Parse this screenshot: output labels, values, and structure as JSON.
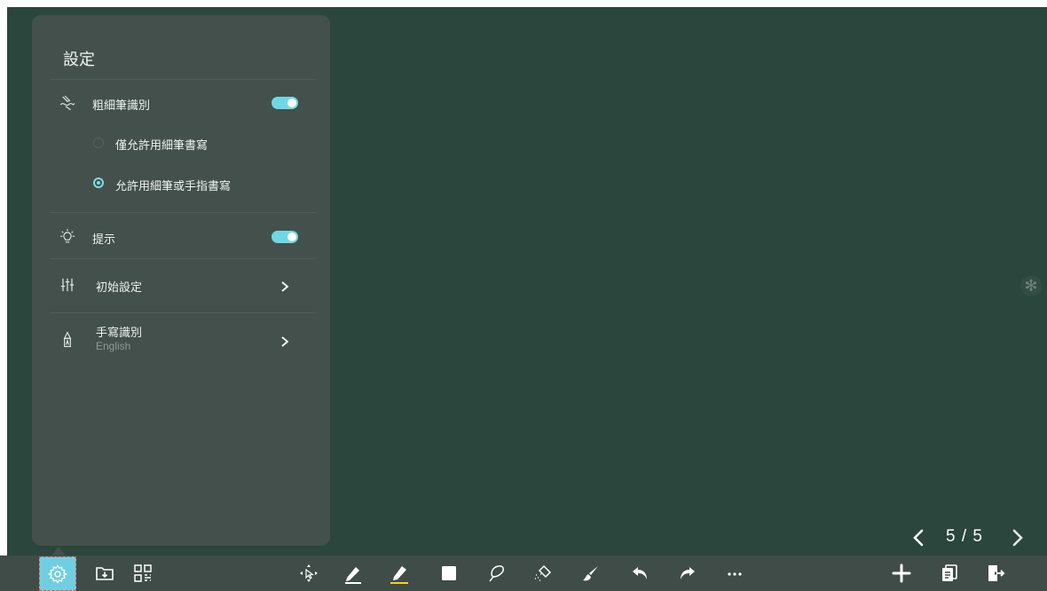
{
  "settings_panel": {
    "title": "設定",
    "rows": [
      {
        "icon": "pen-detect-icon",
        "label": "粗細筆識別",
        "toggle": true
      },
      {
        "icon": "lightbulb-icon",
        "label": "提示",
        "toggle": true
      },
      {
        "icon": "sliders-icon",
        "label": "初始設定"
      },
      {
        "icon": "handwriting-icon",
        "label": "手寫識別",
        "sub": "English"
      }
    ],
    "radio_options": [
      {
        "label": "僅允許用細筆書寫",
        "selected": false
      },
      {
        "label": "允許用細筆或手指書寫",
        "selected": true
      }
    ]
  },
  "pager": {
    "text": "5 / 5"
  },
  "colors": {
    "board": "#2b463c",
    "panel": "#43504b",
    "accent": "#6fd8e4",
    "toolbar": "#3f4c47",
    "highlighter": "#f1d21b"
  },
  "toolbar": {
    "left": [
      "gear-icon",
      "folder-download-icon",
      "qr-code-icon"
    ],
    "center": [
      "move-select-icon",
      "pen-icon",
      "highlighter-icon",
      "shape-icon",
      "lasso-icon",
      "eraser-icon",
      "brush-clear-icon",
      "undo-icon",
      "redo-icon",
      "more-icon"
    ],
    "right": [
      "add-page-icon",
      "pages-icon",
      "exit-icon"
    ]
  }
}
